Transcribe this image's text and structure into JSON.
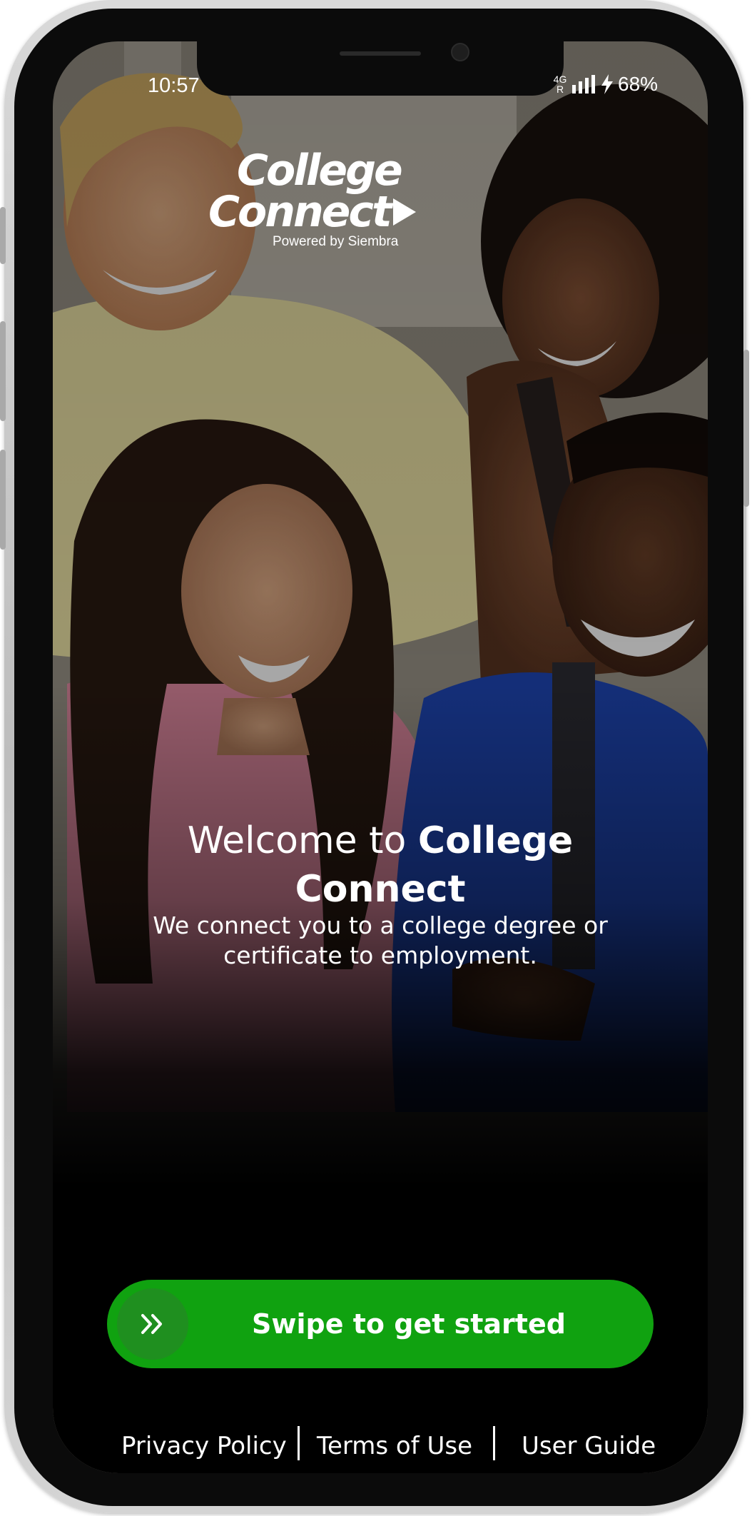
{
  "status_bar": {
    "time": "10:57",
    "network": "4G",
    "network_sub": "R",
    "signal_icon": "signal-bars-icon",
    "charging_icon": "charging-bolt-icon",
    "battery": "68%"
  },
  "logo": {
    "line1": "College",
    "line2": "Connect",
    "powered_by": "Powered by Siembra"
  },
  "welcome": {
    "prefix": "Welcome to ",
    "brand_line1": "College",
    "brand_line2": "Connect"
  },
  "subtitle": {
    "line1": "We connect you to a college degree or",
    "line2": "certificate to employment."
  },
  "swipe": {
    "label": "Swipe to get started",
    "handle_icon": "double-chevron-right-icon",
    "color": "#10a210"
  },
  "footer": {
    "privacy": "Privacy Policy",
    "terms": "Terms of Use",
    "guide": "User Guide"
  }
}
